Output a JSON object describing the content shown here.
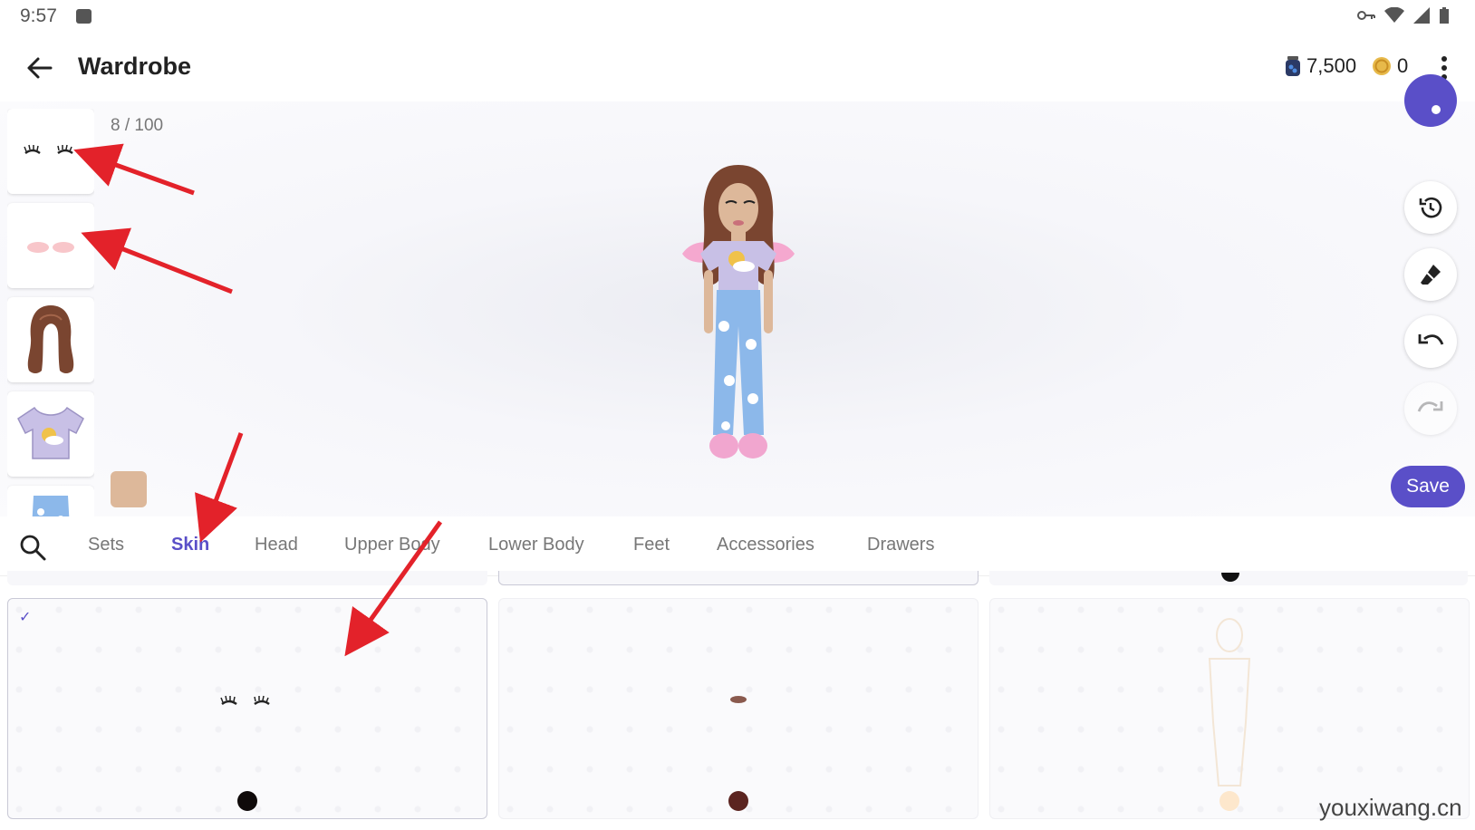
{
  "status": {
    "time": "9:57"
  },
  "appbar": {
    "title": "Wardrobe",
    "gems": "7,500",
    "coins": "0"
  },
  "stage": {
    "item_count": "8 / 100",
    "save_label": "Save"
  },
  "tabs": [
    {
      "label": "Sets"
    },
    {
      "label": "Skin"
    },
    {
      "label": "Head"
    },
    {
      "label": "Upper Body"
    },
    {
      "label": "Lower Body"
    },
    {
      "label": "Feet"
    },
    {
      "label": "Accessories"
    },
    {
      "label": "Drawers"
    }
  ],
  "active_tab": "Skin",
  "swatch_colors": [
    "#0f0a0a",
    "#5b2420",
    "#fde7cc"
  ],
  "accent_color": "#5a4fc8",
  "watermark": "youxiwang.cn"
}
